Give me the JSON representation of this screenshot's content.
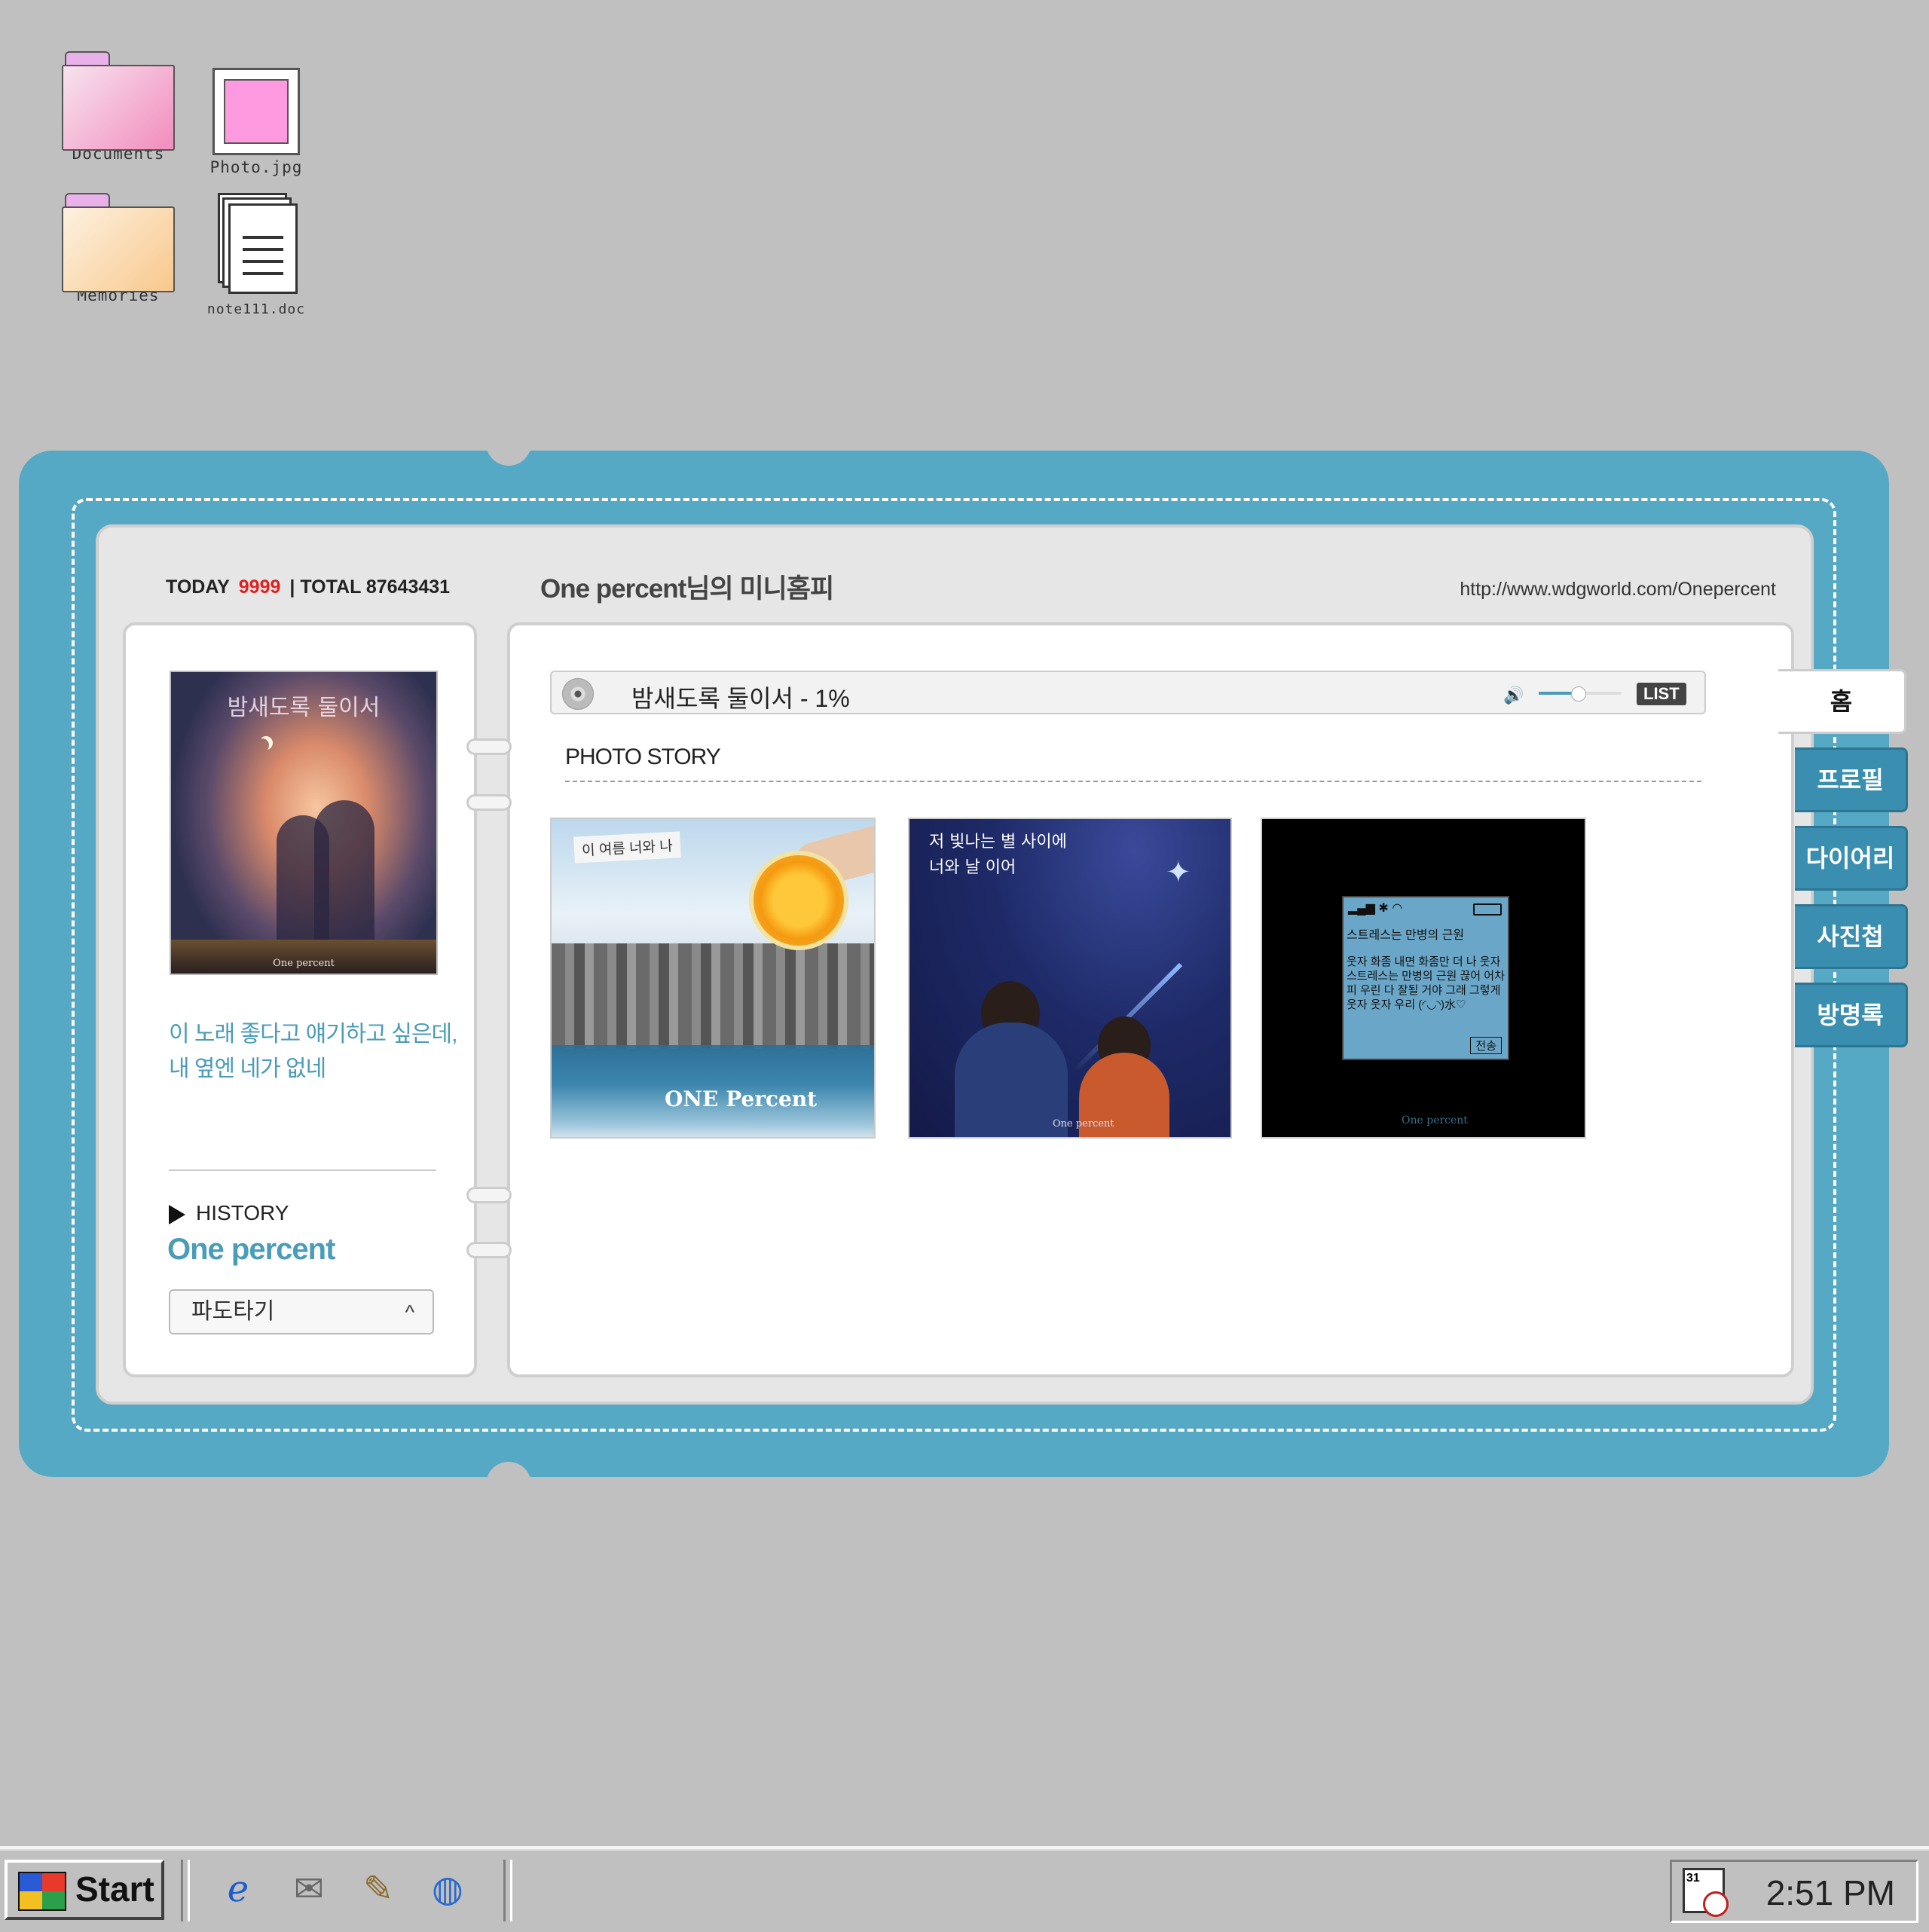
{
  "desktop": {
    "icons": [
      {
        "label": "Documents"
      },
      {
        "label": "Photo.jpg"
      },
      {
        "label": "Memories"
      },
      {
        "label": "note111.doc"
      }
    ]
  },
  "minihompy": {
    "today_label": "TODAY",
    "today_count": "9999",
    "total_label": "| TOTAL 87643431",
    "title": "One percent님의 미니홈피",
    "url": "http://www.wdgworld.com/Onepercent",
    "left": {
      "album_title": "밤새도록 둘이서",
      "album_brand": "One percent",
      "quote_line1": "이 노래 좋다고 얘기하고 싶은데,",
      "quote_line2": "내 옆엔 네가 없네",
      "history_label": "HISTORY",
      "history_name": "One percent",
      "select_value": "파도타기",
      "select_caret": "^"
    },
    "player": {
      "song": "밤새도록 둘이서 - 1%",
      "speaker_icon": "🔊",
      "volume_percent": 47,
      "list_label": "LIST"
    },
    "photo_story": {
      "title": "PHOTO STORY",
      "photos": [
        {
          "caption": "이 여름 너와 나",
          "brand": "ONE Percent"
        },
        {
          "caption_line1": "저 빛나는 별 사이에",
          "caption_line2": "너와 날 이어",
          "brand": "One percent"
        },
        {
          "status": "▂▄▆ ✱ ◠",
          "title": "스트레스는 만병의 근원",
          "body": "웃자 화좀 내면 화좀만 더 나 웃자 스트레스는 만병의 근원 끊어 어차피 우린 다 잘될 거야 그래 그렇게 웃자 웃자 우리 (◜◡◝)水♡",
          "send": "전송",
          "brand": "One percent"
        }
      ]
    },
    "tabs": [
      "홈",
      "프로필",
      "다이어리",
      "사진첩",
      "방명록"
    ]
  },
  "taskbar": {
    "start_label": "Start",
    "quicklaunch": [
      "internet-explorer-icon",
      "outlook-icon",
      "notepad-icon",
      "globe-icon"
    ],
    "tray_calendar": "31",
    "time": "2:51 PM"
  }
}
